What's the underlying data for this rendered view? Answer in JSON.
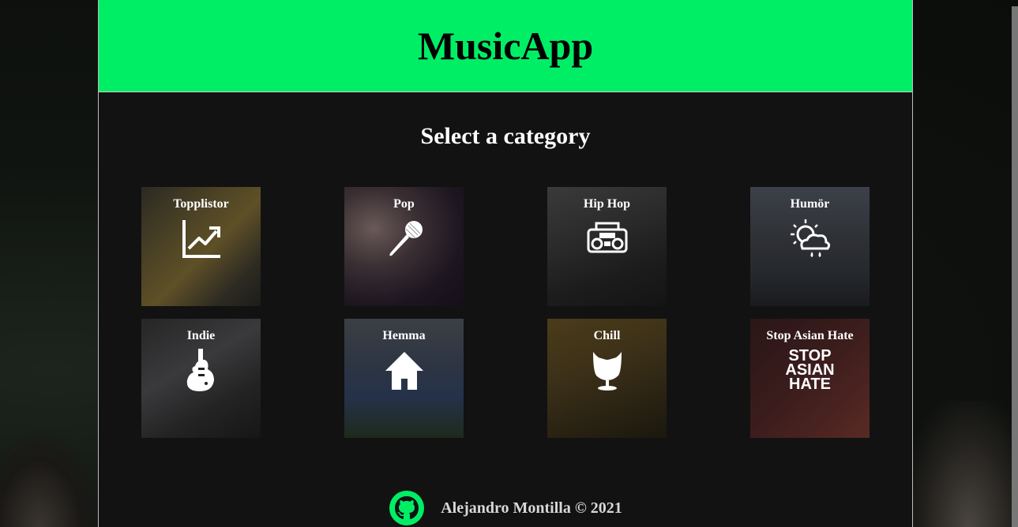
{
  "header": {
    "title": "MusicApp"
  },
  "main": {
    "subtitle": "Select a category"
  },
  "categories": [
    {
      "label": "Topplistor",
      "icon": "chart-trend-icon"
    },
    {
      "label": "Pop",
      "icon": "microphone-icon"
    },
    {
      "label": "Hip Hop",
      "icon": "boombox-icon"
    },
    {
      "label": "Humör",
      "icon": "weather-mood-icon"
    },
    {
      "label": "Indie",
      "icon": "electric-guitar-icon"
    },
    {
      "label": "Hemma",
      "icon": "home-icon"
    },
    {
      "label": "Chill",
      "icon": "egg-chair-icon"
    },
    {
      "label": "Stop Asian Hate",
      "icon": "stop-asian-hate-logo",
      "logo_text": [
        "STOP",
        "ASIAN",
        "HATE"
      ]
    }
  ],
  "footer": {
    "credit": "Alejandro Montilla © 2021",
    "icon": "github-icon"
  },
  "colors": {
    "accent": "#00ee66",
    "panel": "#121212"
  }
}
